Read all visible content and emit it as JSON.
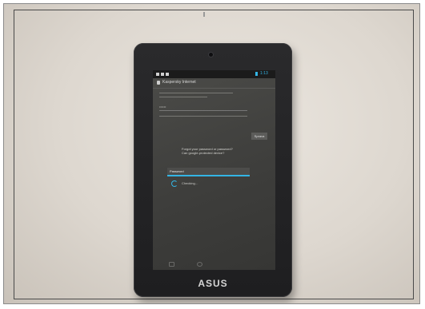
{
  "screen": {
    "status_time": "1:13",
    "action_title": "Kaspersky Internet",
    "password_hint": "••••••",
    "side_button": "Sprava",
    "message": "Forgot your password or password?\nCan google-protected device?",
    "input_value": "Password",
    "spinner_label": "Checking…"
  },
  "device": {
    "brand": "ASUS"
  },
  "colors": {
    "accent": "#33b5e5",
    "bezel": "#222224"
  }
}
